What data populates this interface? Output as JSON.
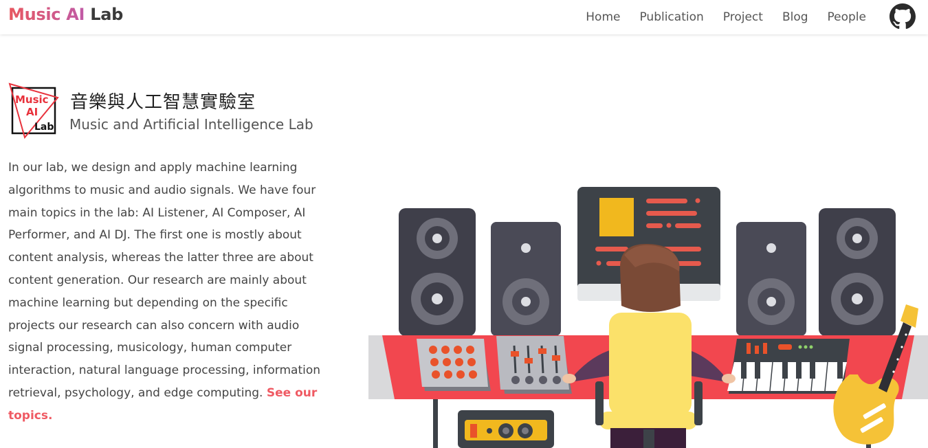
{
  "nav": {
    "brand_accent": "Music AI",
    "brand_rest": "Lab",
    "links": [
      {
        "label": "Home"
      },
      {
        "label": "Publication"
      },
      {
        "label": "Project"
      },
      {
        "label": "Blog"
      },
      {
        "label": "People"
      }
    ],
    "github_icon": "github-icon"
  },
  "hero": {
    "logo_lines": [
      "Music",
      "AI",
      "Lab"
    ],
    "title_cn": "音樂與人工智慧實驗室",
    "title_en": "Music and Artificial Intelligence Lab",
    "intro": "In our lab, we design and apply machine learning algorithms to music and audio signals. We have four main topics in the lab: AI Listener, AI Composer, AI Performer, and AI DJ. The first one is mostly about content analysis, whereas the latter three are about content generation. Our research are mainly about machine learning but depending on the specific projects our research can also concern with audio signal processing, musicology, human computer interaction, natural language processing, information retrieval, psychology, and edge computing.",
    "link_label": "See our topics."
  },
  "colors": {
    "accent": "#ef5a63",
    "brand_gradient_end": "#c05aa6",
    "desk_red": "#f2474f",
    "speaker_dark": "#3f3f4a",
    "monitor_dark": "#3d4248"
  }
}
